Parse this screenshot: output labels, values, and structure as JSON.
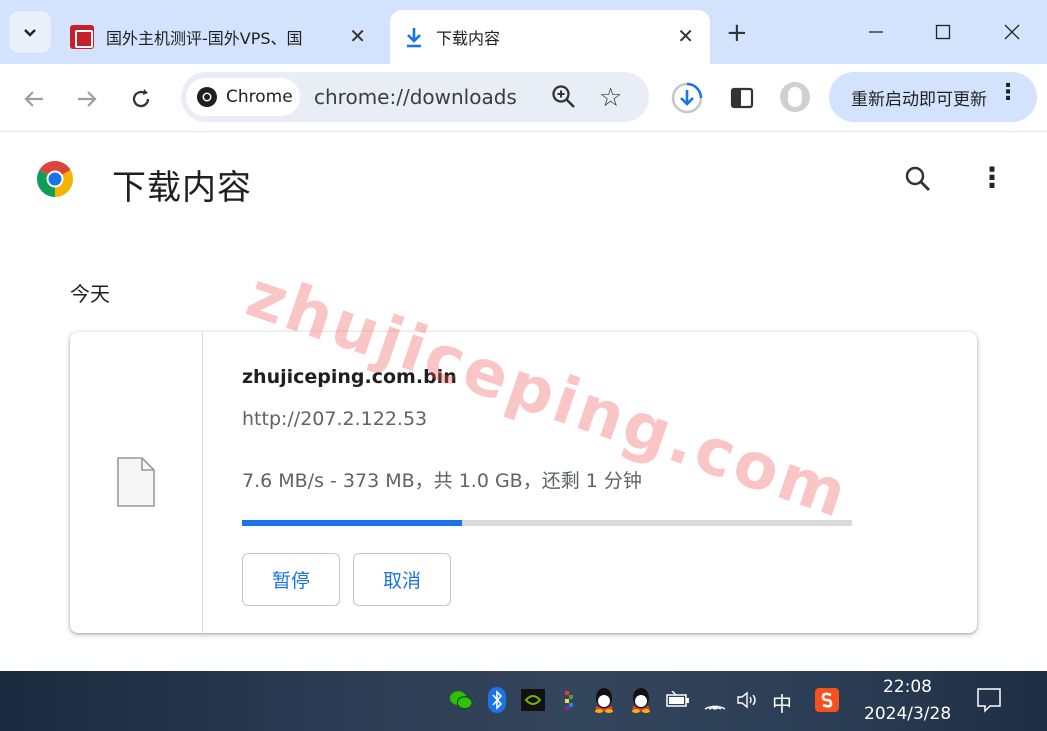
{
  "tabs": [
    {
      "label": "国外主机测评-国外VPS、国",
      "active": false
    },
    {
      "label": "下载内容",
      "active": true
    }
  ],
  "toolbar": {
    "chip_label": "Chrome",
    "url": "chrome://downloads",
    "update_label": "重新启动即可更新"
  },
  "page": {
    "title": "下载内容",
    "section": "今天"
  },
  "download": {
    "filename": "zhujiceping.com.bin",
    "url": "http://207.2.122.53",
    "status": "7.6 MB/s - 373 MB，共 1.0 GB，还剩 1 分钟",
    "progress": 0.36,
    "pause_label": "暂停",
    "cancel_label": "取消"
  },
  "watermark": "zhujiceping.com",
  "taskbar": {
    "ime_label": "中",
    "time": "22:08",
    "date": "2024/3/28"
  },
  "colors": {
    "accent": "#1a73e8",
    "tabstrip": "#d3e3fd",
    "omnibox": "#e9eef6"
  }
}
